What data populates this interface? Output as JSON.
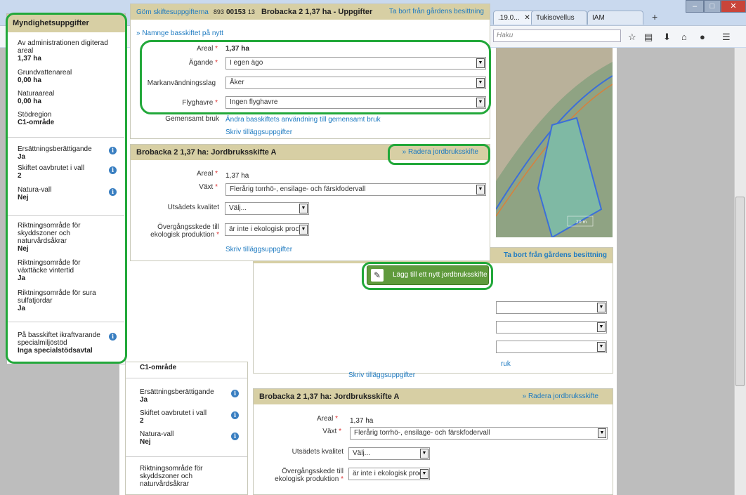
{
  "browser": {
    "tabs": [
      ".19.0...",
      "Tukisovellus 1....",
      "IAM"
    ],
    "new_tab": "+",
    "url_placeholder": "Haku",
    "window_buttons": [
      "–",
      "□",
      "✕"
    ]
  },
  "sidebar_front": {
    "title": "Myndighetsuppgifter",
    "items": [
      {
        "label": "Av administrationen digiterad areal",
        "value": "1,37 ha"
      },
      {
        "label": "Grundvattenareal",
        "value": "0,00 ha"
      },
      {
        "label": "Naturaareal",
        "value": "0,00 ha"
      },
      {
        "label": "Stödregion",
        "value": "C1-område"
      },
      {
        "label": "Ersättningsberättigande",
        "value": "Ja"
      },
      {
        "label": "Skiftet oavbrutet i vall",
        "value": "2"
      },
      {
        "label": "Natura-vall",
        "value": "Nej"
      },
      {
        "label": "Riktningsområde för skyddszoner och naturvårdsåkrar",
        "value": "Nej"
      },
      {
        "label": "Riktningsområde för växttäcke vintertid",
        "value": "Ja"
      },
      {
        "label": "Riktningsområde för sura sulfatjordar",
        "value": "Ja"
      },
      {
        "label": "På basskiftet ikraftvarande specialmiljöstöd",
        "value": "Inga specialstödsavtal"
      }
    ]
  },
  "sidebar_back": {
    "region_value": "C1-område",
    "items": [
      {
        "label": "Ersättningsberättigande",
        "value": "Ja"
      },
      {
        "label": "Skiftet oavbrutet i vall",
        "value": "2"
      },
      {
        "label": "Natura-vall",
        "value": "Nej"
      },
      {
        "label": "Riktningsområde för skyddszoner och naturvårdsåkrar",
        "value": ""
      }
    ]
  },
  "tasks_panel": {
    "hide_link": "Göm skiftesuppgifterna",
    "id_prefix": "893",
    "id_main": "00153",
    "id_suffix": "13",
    "title": "Brobacka 2 1,37 ha - Uppgifter",
    "remove_link": "Ta bort från gårdens besittning",
    "rename_link": "» Namnge basskiftet på nytt",
    "fields": {
      "areal_label": "Areal",
      "areal_value": "1,37 ha",
      "agande_label": "Ägande",
      "agande_value": "I egen ägo",
      "markanv_label": "Markanvändningsslag",
      "markanv_value": "Åker",
      "flyghavre_label": "Flyghavre",
      "flyghavre_value": "Ingen flyghavre",
      "gemensamt_label": "Gemensamt bruk",
      "gemensamt_link": "Ändra basskiftets användning till gemensamt bruk",
      "extra_link": "Skriv tilläggsuppgifter"
    }
  },
  "farm_block": {
    "title": "Brobacka 2 1,37 ha: Jordbruksskifte A",
    "delete_link": "» Radera jordbruksskifte",
    "areal_label": "Areal",
    "areal_value": "1,37  ha",
    "vaxt_label": "Växt",
    "vaxt_value": "Flerårig torrhö-, ensilage- och färskfodervall",
    "kvalitet_label": "Utsädets kvalitet",
    "kvalitet_value": "Välj...",
    "overgang_label": "Övergångsskede till ekologisk produktion",
    "overgang_value": "är inte i ekologisk proc",
    "extra_link": "Skriv tilläggsuppgifter"
  },
  "add_button": {
    "label": "Lägg till ett nytt jordbruksskifte"
  },
  "back_panel": {
    "remove_link": "Ta bort från gårdens besittning",
    "bruk_fragment": "ruk",
    "extra_link": "Skriv tilläggsuppgifter",
    "farm_title": "Brobacka 2 1,37 ha: Jordbruksskifte A",
    "delete_link": "» Radera jordbruksskifte",
    "areal_label": "Areal",
    "areal_value": "1,37  ha",
    "vaxt_label": "Växt",
    "vaxt_value": "Flerårig torrhö-, ensilage- och färskfodervall",
    "kvalitet_label": "Utsädets kvalitet",
    "kvalitet_value": "Välj...",
    "overgang_label": "Övergångsskede till ekologisk produktion",
    "overgang_value": "är inte i ekologisk proc"
  },
  "map": {
    "scale_label": "20 m"
  },
  "colors": {
    "highlight": "#22a83a",
    "panel_header": "#d7cfa4",
    "link": "#1f7bc1",
    "button": "#5f9a3c"
  }
}
